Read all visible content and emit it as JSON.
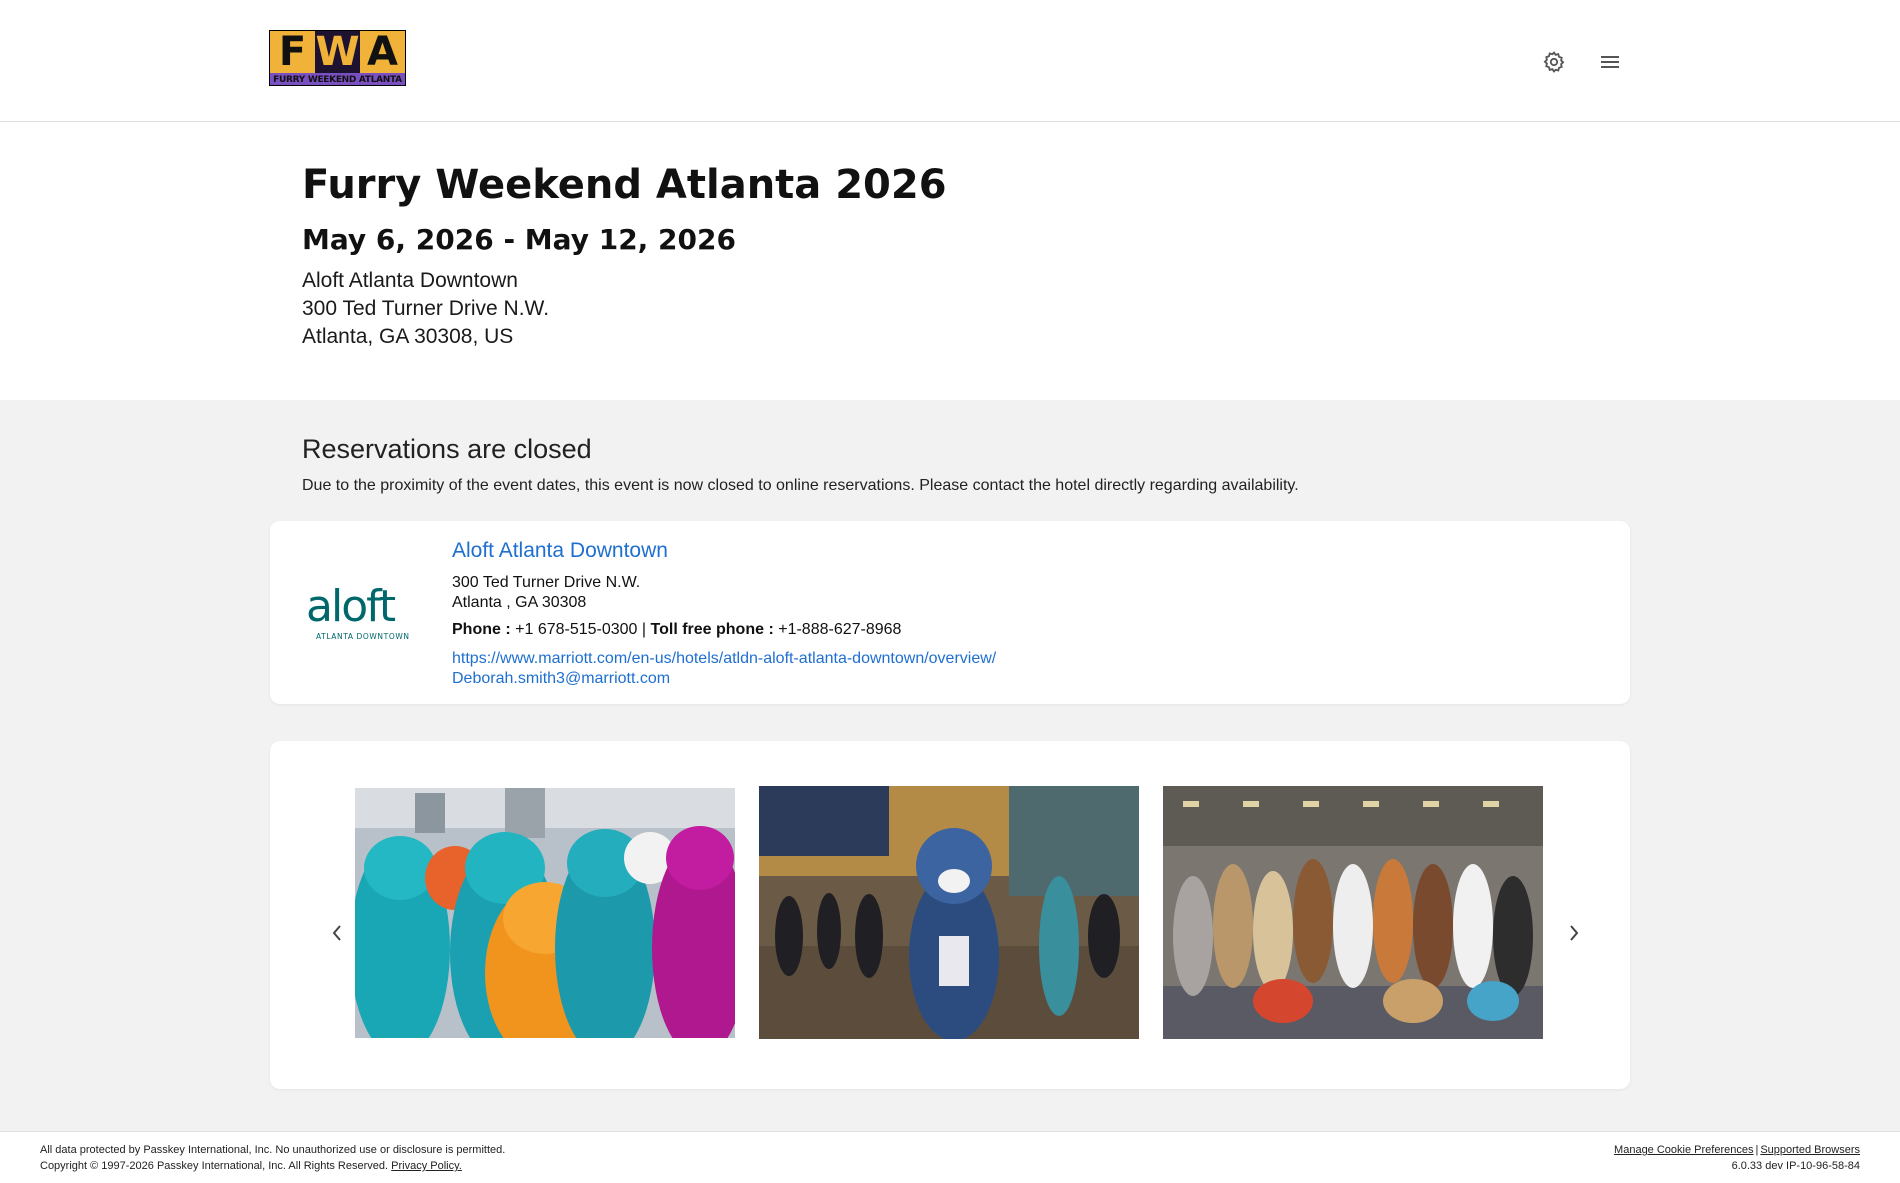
{
  "header": {
    "logo": {
      "letters": [
        "F",
        "W",
        "A"
      ],
      "subtitle": "FURRY WEEKEND ATLANTA"
    },
    "settings_icon": "gear-icon",
    "menu_icon": "hamburger-menu-icon"
  },
  "event": {
    "title": "Furry Weekend Atlanta 2026",
    "dates": "May 6, 2026 - May 12, 2026",
    "venue": "Aloft Atlanta Downtown",
    "street": "300 Ted Turner Drive N.W.",
    "city_line": "Atlanta, GA 30308, US"
  },
  "reservations": {
    "heading": "Reservations are closed",
    "message": "Due to the proximity of the event dates, this event is now closed to online reservations. Please contact the hotel directly regarding availability."
  },
  "hotel": {
    "logo_text": "aloft",
    "logo_sub": "ATLANTA DOWNTOWN",
    "name": "Aloft Atlanta Downtown",
    "street": "300 Ted Turner Drive N.W.",
    "city_line": "Atlanta , GA 30308",
    "phone_label": "Phone :",
    "phone": "+1 678-515-0300",
    "separator": "|",
    "toll_free_label": "Toll free phone :",
    "toll_free": "+1-888-627-8968",
    "website": "https://www.marriott.com/en-us/hotels/atldn-aloft-atlanta-downtown/overview/",
    "email": "Deborah.smith3@marriott.com",
    "brand_color": "#00676b"
  },
  "gallery": {
    "prev_icon": "chevron-left-icon",
    "next_icon": "chevron-right-icon",
    "photos": [
      "costumed-group-photo",
      "costumed-character-lobby-photo",
      "costumed-group-lobby-photo"
    ]
  },
  "footer": {
    "line1": "All data protected by Passkey International, Inc. No unauthorized use or disclosure is permitted.",
    "line2": "Copyright © 1997-2026 Passkey International, Inc. All Rights Reserved.",
    "privacy_link": "Privacy Policy.",
    "cookie_link": "Manage Cookie Preferences",
    "link_separator": "|",
    "browsers_link": "Supported Browsers",
    "version": "6.0.33 dev IP-10-96-58-84"
  },
  "colors": {
    "link": "#1e6fd0",
    "page_bg": "#f2f2f3",
    "logo_gold": "#f0b239",
    "logo_purple": "#7a4fc0"
  }
}
